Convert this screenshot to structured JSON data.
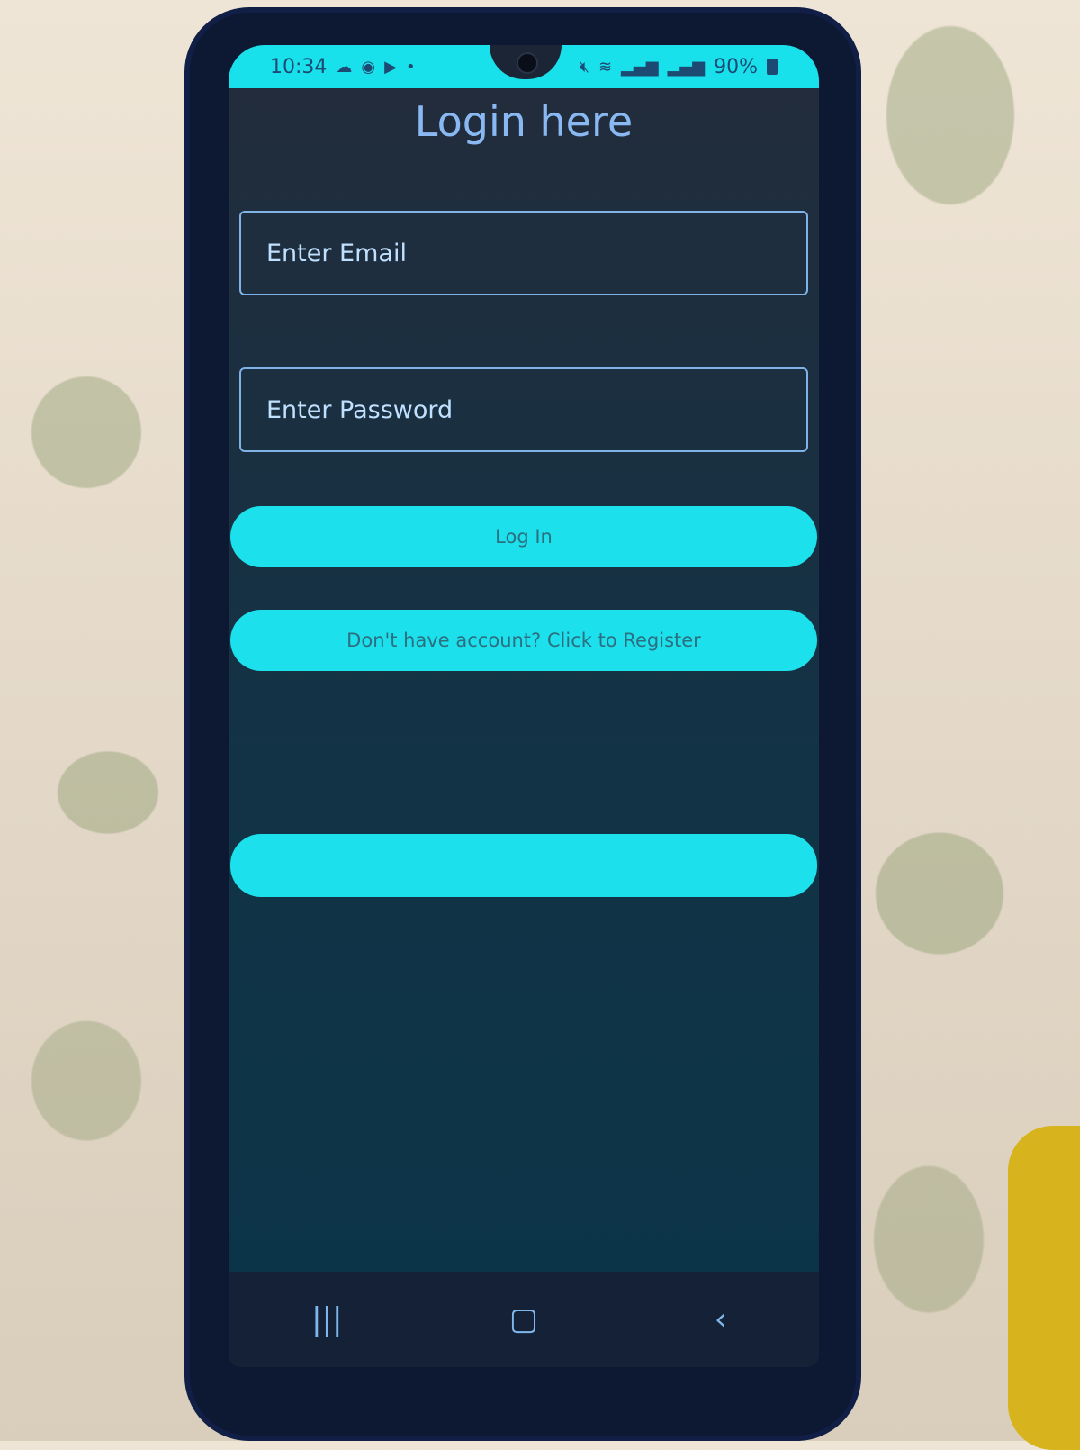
{
  "status_bar": {
    "time": "10:34",
    "left_icons": [
      "cloud-icon",
      "whatsapp-icon",
      "youtube-icon",
      "dot-icon"
    ],
    "right_icons": [
      "mute-icon",
      "wifi-icon",
      "signal-icon",
      "volte-icon",
      "signal-icon"
    ],
    "battery": "90%"
  },
  "login": {
    "title": "Login here",
    "email_placeholder": "Enter Email",
    "password_placeholder": "Enter Password",
    "login_button": "Log In",
    "register_button": "Don't have account? Click to Register",
    "blank_button": ""
  },
  "nav": {
    "recents_icon": "recents-icon",
    "home_icon": "home-icon",
    "back_icon": "back-icon"
  },
  "colors": {
    "accent": "#1ce0eb",
    "title": "#8ab8f3",
    "field_border": "#7fb3e8",
    "background": "#1a2f44"
  }
}
